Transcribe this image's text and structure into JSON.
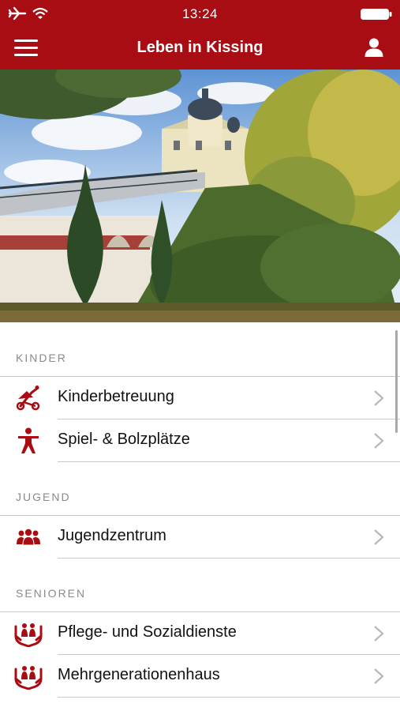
{
  "status_bar": {
    "time": "13:24",
    "airplane_icon": "airplane-icon",
    "wifi_icon": "wifi-icon",
    "battery_icon": "battery-icon"
  },
  "navbar": {
    "title": "Leben in Kissing",
    "menu_icon": "hamburger-menu-icon",
    "user_icon": "user-icon"
  },
  "colors": {
    "brand": "#a70d12",
    "section_header": "#8a8a8f",
    "separator": "#c8c7cc",
    "chevron": "#b8b8bd"
  },
  "sections": [
    {
      "header": "KINDER",
      "items": [
        {
          "label": "Kinderbetreuung",
          "icon": "stroller-icon"
        },
        {
          "label": "Spiel- & Bolzplätze",
          "icon": "child-figure-icon"
        }
      ]
    },
    {
      "header": "JUGEND",
      "items": [
        {
          "label": "Jugendzentrum",
          "icon": "group-icon"
        }
      ]
    },
    {
      "header": "SENIOREN",
      "items": [
        {
          "label": "Pflege- und Sozialdienste",
          "icon": "caring-hands-icon"
        },
        {
          "label": "Mehrgenerationenhaus",
          "icon": "caring-hands-icon"
        }
      ]
    }
  ]
}
